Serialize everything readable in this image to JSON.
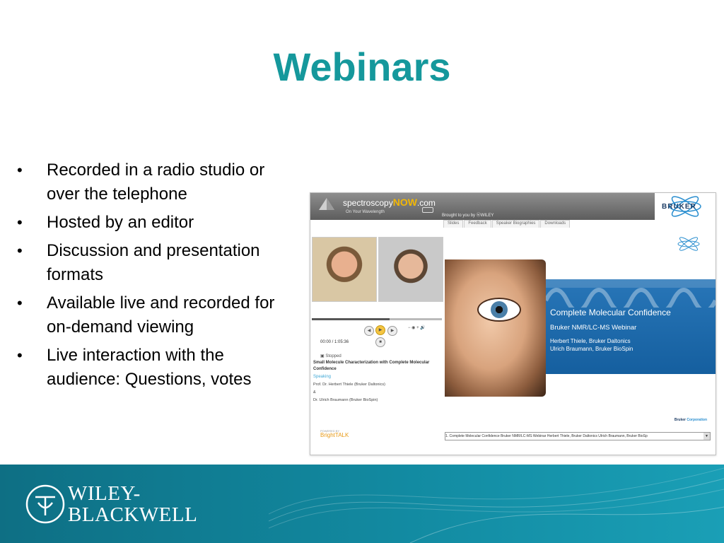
{
  "slide": {
    "title": "Webinars",
    "bullets": [
      "Recorded in a radio studio or over the telephone",
      "Hosted by an editor",
      "Discussion and presentation formats",
      "Available live and recorded for on-demand viewing",
      "Live interaction with the audience: Questions, votes"
    ],
    "bullet_char": "•"
  },
  "screenshot": {
    "brand_left": "spectroscopy",
    "brand_now": "NOW",
    "brand_com": ".com",
    "tagline": "On Your Wavelength",
    "brought_by": "Brought to you by ⓦWILEY",
    "sponsor": "BRUKER",
    "tabs": [
      "Slides",
      "Feedback",
      "Speaker Biographies",
      "Downloads"
    ],
    "status": "Stopped",
    "time": "00:00 / 1:05:36",
    "session_title": "Small Molecule Characterization with Complete Molecular Confidence",
    "speaking_label": "Speaking",
    "speaker1": "Prof. Dr. Herbert Thiele (Bruker Daltonics)",
    "amp": "&",
    "speaker2": "Dr. Ulrich Braumann (Bruker BioSpin)",
    "powered_by": "POWERED BY",
    "brighttalk": "BrightTALK",
    "slide_title": "Complete Molecular Confidence",
    "slide_subtitle": "Bruker NMR/LC-MS Webinar",
    "slide_names1": "Herbert Thiele, Bruker Daltonics",
    "slide_names2": "Ulrich Braumann, Bruker BioSpin",
    "corp_left": "Bruker ",
    "corp_right": "Corporation",
    "select_value": "1. Complete Molecular Confidence Bruker NMR/LC-MS Webinar  Herbert Thiele, Bruker Daltonics Ulrich Braumann, Bruker BioSp"
  },
  "footer": {
    "brand_line1": "WILEY-",
    "brand_line2": "BLACKWELL"
  },
  "colors": {
    "title": "#15989c",
    "footer": "#128aa1",
    "slide_blue": "#1d6dae"
  }
}
